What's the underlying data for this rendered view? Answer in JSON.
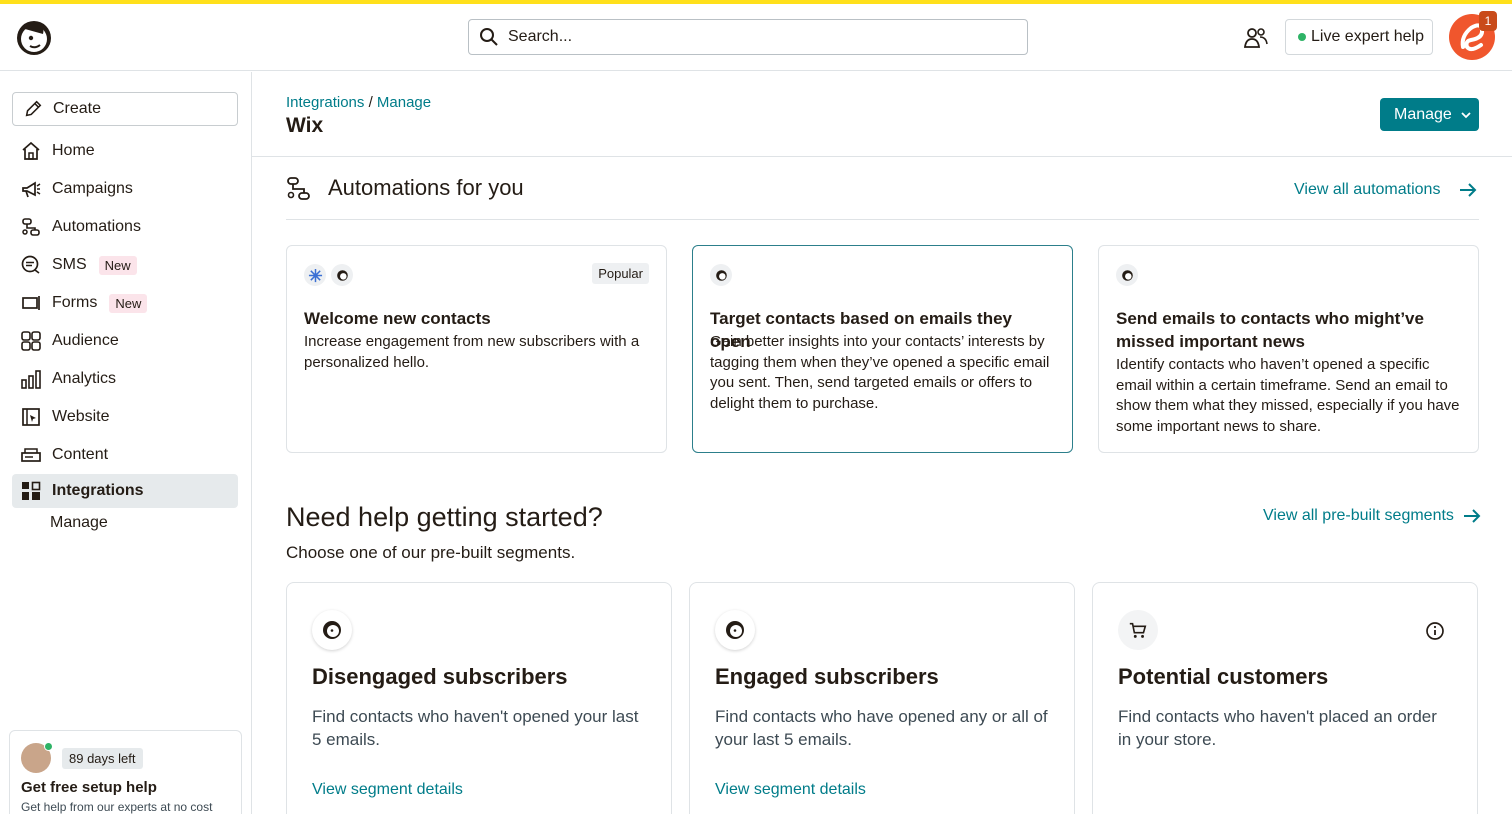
{
  "header": {
    "search_placeholder": "Search...",
    "live_help_label": "Live expert help",
    "notification_count": "1"
  },
  "sidebar": {
    "create_label": "Create",
    "items": [
      {
        "label": "Home"
      },
      {
        "label": "Campaigns"
      },
      {
        "label": "Automations"
      },
      {
        "label": "SMS",
        "badge": "New"
      },
      {
        "label": "Forms",
        "badge": "New"
      },
      {
        "label": "Audience"
      },
      {
        "label": "Analytics"
      },
      {
        "label": "Website"
      },
      {
        "label": "Content"
      },
      {
        "label": "Integrations"
      }
    ],
    "sub_item": "Manage",
    "trial": {
      "days_left": "89 days left",
      "title": "Get free setup help",
      "subtitle": "Get help from our experts at no cost"
    }
  },
  "main": {
    "breadcrumb": [
      "Integrations",
      "/",
      "Manage"
    ],
    "title": "Wix",
    "manage_button": "Manage",
    "automations": {
      "title": "Automations for you",
      "view_all": "View all automations",
      "cards": [
        {
          "badge": "Popular",
          "title": "Welcome new contacts",
          "description": "Increase engagement from new subscribers with a personalized hello."
        },
        {
          "title": "Target contacts based on emails they open",
          "description": "Gain better insights into your contacts’ interests by tagging them when they’ve opened a specific email you sent. Then, send targeted emails or offers to delight them to purchase."
        },
        {
          "title": "Send emails to contacts who might’ve missed important news",
          "description": "Identify contacts who haven’t opened a specific email within a certain timeframe. Send an email to show them what they missed, especially if you have some important news to share."
        }
      ]
    },
    "segments": {
      "title": "Need help getting started?",
      "subtitle": "Choose one of our pre-built segments.",
      "view_all": "View all pre-built segments",
      "cards": [
        {
          "title": "Disengaged subscribers",
          "description": "Find contacts who haven't opened your last 5 emails.",
          "link": "View segment details"
        },
        {
          "title": "Engaged subscribers",
          "description": "Find contacts who have opened any or all of your last 5 emails.",
          "link": "View segment details"
        },
        {
          "title": "Potential customers",
          "description": "Find contacts who haven't placed an order in your store."
        }
      ]
    }
  },
  "colors": {
    "accent": "#ffe01b",
    "link": "#007c89",
    "button": "#007c89",
    "new_badge": "#fbe4ea",
    "active_nav": "#e6eaec"
  },
  "icons": [
    "mailchimp-logo",
    "search-icon",
    "people-icon",
    "pencil-icon",
    "home-icon",
    "megaphone-icon",
    "automations-icon",
    "sms-icon",
    "forms-icon",
    "audience-icon",
    "analytics-icon",
    "website-icon",
    "content-icon",
    "integrations-icon",
    "chevron-down-icon",
    "arrow-right-icon",
    "info-icon",
    "cart-icon"
  ]
}
